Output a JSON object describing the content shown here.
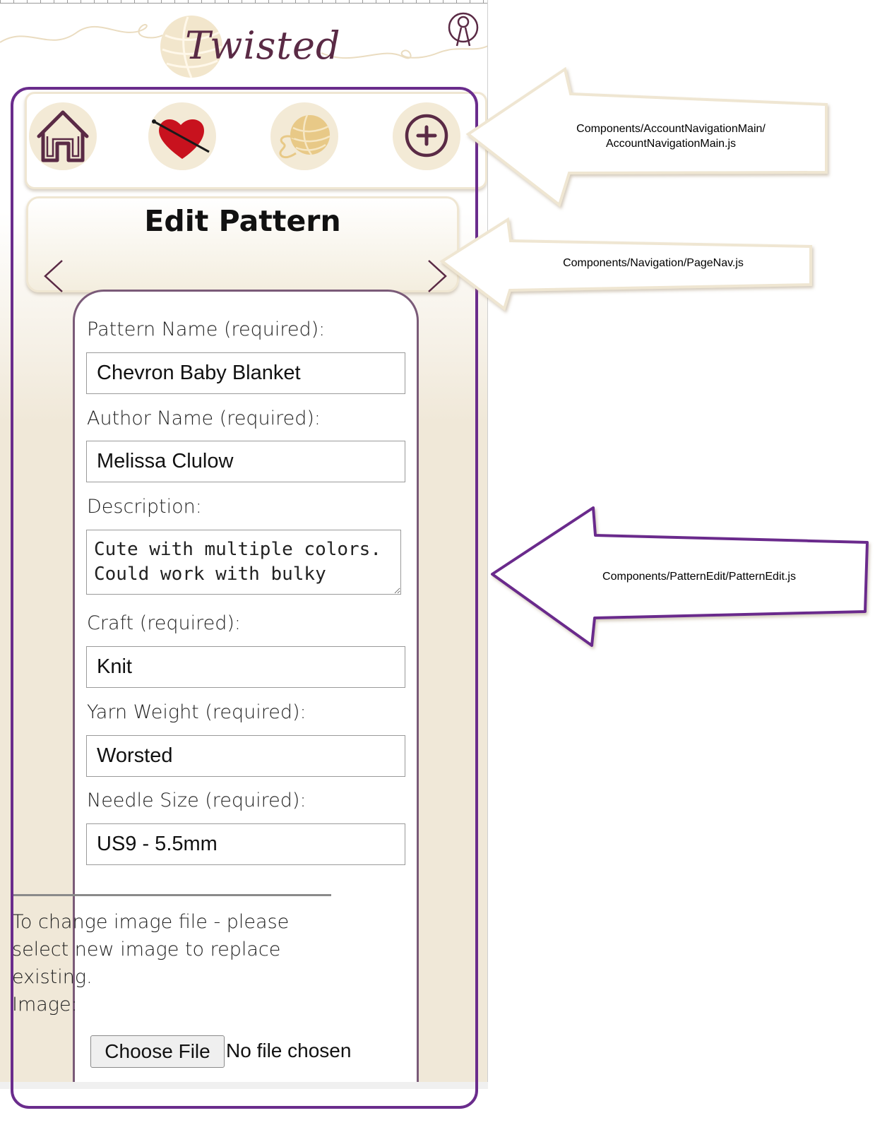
{
  "app": {
    "logo_text": "Twisted"
  },
  "account_nav": {
    "items": [
      {
        "icon": "home-icon"
      },
      {
        "icon": "heart-needle-icon"
      },
      {
        "icon": "yarn-ball-icon"
      },
      {
        "icon": "add-circle-icon"
      }
    ]
  },
  "page_nav": {
    "title": "Edit Pattern"
  },
  "form": {
    "pattern_name_label": "Pattern Name (required):",
    "pattern_name_value": "Chevron Baby Blanket",
    "author_label": "Author Name (required):",
    "author_value": "Melissa Clulow",
    "description_label": "Description:",
    "description_value": "Cute with multiple colors. Could work with bulky",
    "craft_label": "Craft (required):",
    "craft_value": "Knit",
    "yarn_weight_label": "Yarn Weight (required):",
    "yarn_weight_value": "Worsted",
    "needle_size_label": "Needle Size (required):",
    "needle_size_value": "US9 - 5.5mm",
    "image_note": "To change image file - please select new image to replace existing.",
    "image_label": "Image:",
    "choose_file_label": "Choose File",
    "file_status": "No file chosen"
  },
  "annotations": {
    "account_nav_line1": "Components/AccountNavigationMain/",
    "account_nav_line2": "AccountNavigationMain.js",
    "page_nav": "Components/Navigation/PageNav.js",
    "pattern_edit": "Components/PatternEdit/PatternEdit.js"
  },
  "colors": {
    "brand_purple": "#5a2a45",
    "outline_purple": "#6a2c8c",
    "cream": "#f3ead6",
    "heart_red": "#c8121e",
    "yarn_gold": "#e8c987"
  }
}
